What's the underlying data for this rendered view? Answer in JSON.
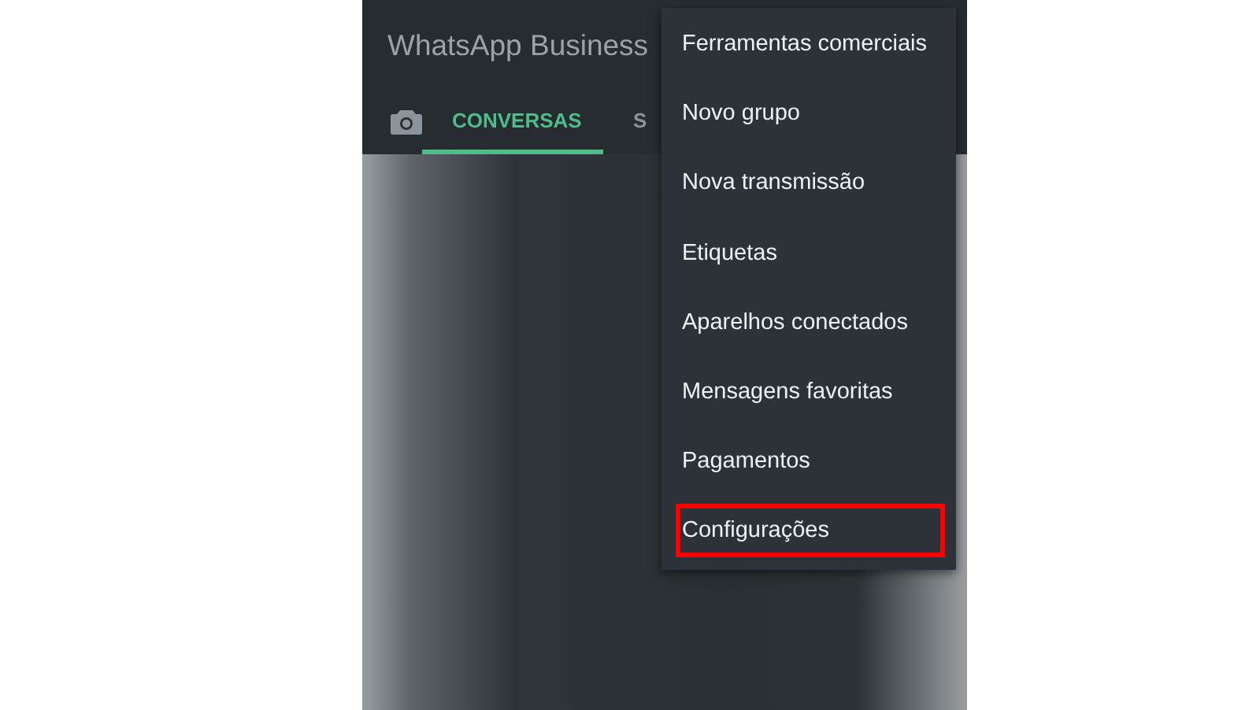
{
  "app_bar": {
    "title": "WhatsApp Business"
  },
  "tabs": [
    {
      "label": "CONVERSAS",
      "selected": true
    },
    {
      "label": "S",
      "selected": false
    }
  ],
  "menu": {
    "items": [
      {
        "label": "Ferramentas comerciais",
        "highlighted": false
      },
      {
        "label": "Novo grupo",
        "highlighted": false
      },
      {
        "label": "Nova transmissão",
        "highlighted": false
      },
      {
        "label": "Etiquetas",
        "highlighted": false
      },
      {
        "label": "Aparelhos conectados",
        "highlighted": false
      },
      {
        "label": "Mensagens favoritas",
        "highlighted": false
      },
      {
        "label": "Pagamentos",
        "highlighted": false
      },
      {
        "label": "Configurações",
        "highlighted": true
      }
    ]
  }
}
